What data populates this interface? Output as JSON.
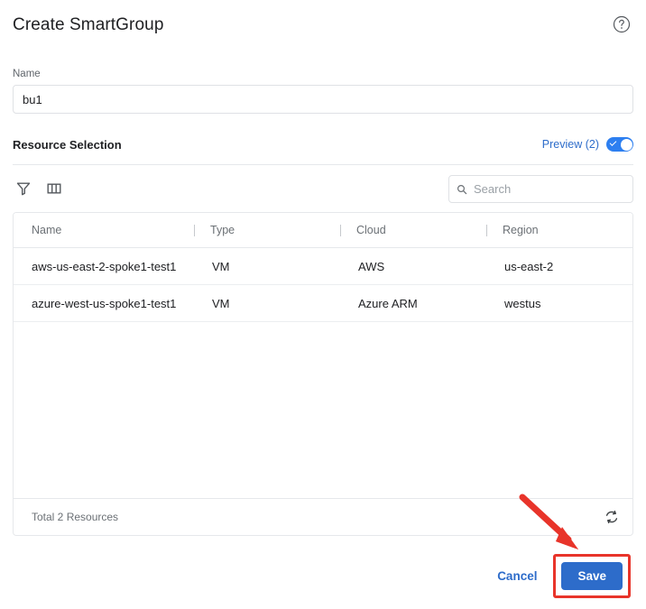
{
  "dialog": {
    "title": "Create SmartGroup",
    "help_icon": "help-circle-icon"
  },
  "name_field": {
    "label": "Name",
    "value": "bu1",
    "placeholder": ""
  },
  "resource_selection": {
    "title": "Resource Selection",
    "preview_label": "Preview (2)",
    "preview_enabled": true
  },
  "toolbar": {
    "filter_icon": "filter-icon",
    "columns_icon": "columns-icon",
    "search_placeholder": "Search",
    "search_value": ""
  },
  "table": {
    "columns": [
      "Name",
      "Type",
      "Cloud",
      "Region"
    ],
    "rows": [
      {
        "name": "aws-us-east-2-spoke1-test1",
        "type": "VM",
        "cloud": "AWS",
        "region": "us-east-2"
      },
      {
        "name": "azure-west-us-spoke1-test1",
        "type": "VM",
        "cloud": "Azure ARM",
        "region": "westus"
      }
    ],
    "footer_text": "Total 2 Resources",
    "refresh_icon": "refresh-icon"
  },
  "actions": {
    "cancel_label": "Cancel",
    "save_label": "Save"
  },
  "colors": {
    "accent_blue": "#2d6cca",
    "toggle_blue": "#2d7ff0",
    "annotation_red": "#e8342a",
    "border_gray": "#e6e8eb",
    "muted_text": "#6b7075"
  }
}
